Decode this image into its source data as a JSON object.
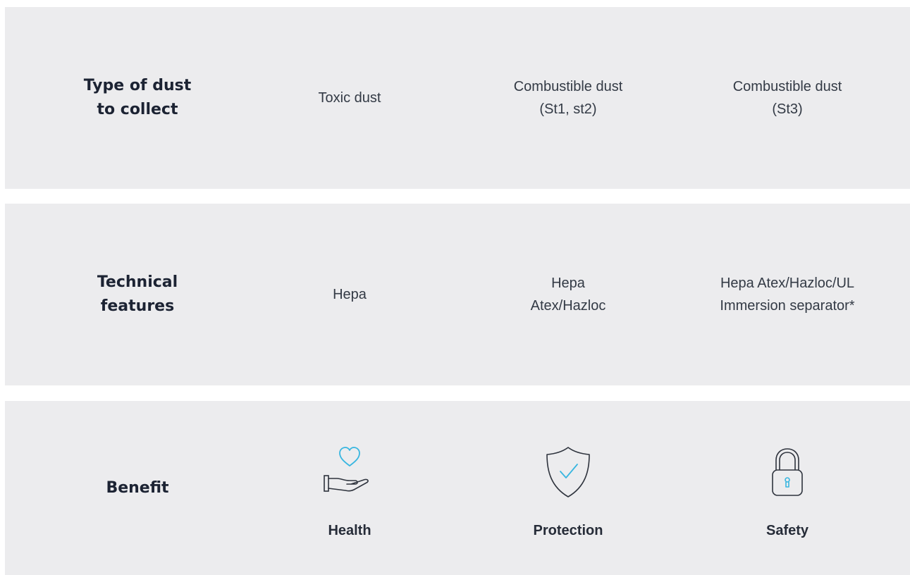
{
  "rows": {
    "dust": {
      "label_line1": "Type of dust",
      "label_line2": "to collect",
      "col1": "Toxic dust",
      "col2_line1": "Combustible dust",
      "col2_line2": "(St1, st2)",
      "col3_line1": "Combustible dust",
      "col3_line2": "(St3)"
    },
    "features": {
      "label_line1": "Technical",
      "label_line2": "features",
      "col1": "Hepa",
      "col2_line1": "Hepa",
      "col2_line2": "Atex/Hazloc",
      "col3_line1": "Hepa Atex/Hazloc/UL",
      "col3_line2": "Immersion separator*"
    },
    "benefit": {
      "label": "Benefit",
      "items": [
        {
          "label": "Health",
          "icon": "heart-in-hand-icon"
        },
        {
          "label": "Protection",
          "icon": "shield-check-icon"
        },
        {
          "label": "Safety",
          "icon": "padlock-icon"
        }
      ]
    }
  },
  "colors": {
    "row_background": "#ececee",
    "heading_text": "#1c2333",
    "body_text": "#333a45",
    "icon_accent": "#38b6e0",
    "icon_outline": "#2e333d"
  }
}
